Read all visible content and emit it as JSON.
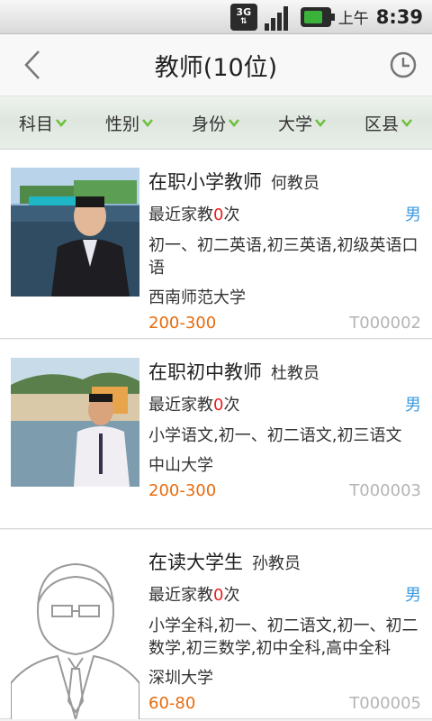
{
  "statusbar": {
    "network": "3G",
    "ampm": "上午",
    "time": "8:39"
  },
  "header": {
    "title": "教师(10位)"
  },
  "filters": [
    {
      "label": "科目"
    },
    {
      "label": "性别"
    },
    {
      "label": "身份"
    },
    {
      "label": "大学"
    },
    {
      "label": "区县"
    }
  ],
  "teachers": [
    {
      "role": "在职小学教师",
      "name": "何教员",
      "recent_prefix": "最近家教",
      "recent_count": "0",
      "recent_suffix": "次",
      "gender": "男",
      "subjects": "初一、初二英语,初三英语,初级英语口语",
      "university": "西南师范大学",
      "price": "200-300",
      "id": "T000002"
    },
    {
      "role": "在职初中教师",
      "name": "杜教员",
      "recent_prefix": "最近家教",
      "recent_count": "0",
      "recent_suffix": "次",
      "gender": "男",
      "subjects": "小学语文,初一、初二语文,初三语文",
      "university": "中山大学",
      "price": "200-300",
      "id": "T000003"
    },
    {
      "role": "在读大学生",
      "name": "孙教员",
      "recent_prefix": "最近家教",
      "recent_count": "0",
      "recent_suffix": "次",
      "gender": "男",
      "subjects": "小学全科,初一、初二语文,初一、初二数学,初三数学,初中全科,高中全科",
      "university": "深圳大学",
      "price": "60-80",
      "id": "T000005"
    }
  ],
  "colors": {
    "price": "#e86b0c",
    "gender": "#3d9be0",
    "count": "#e82020",
    "chevron": "#6cc03a"
  }
}
